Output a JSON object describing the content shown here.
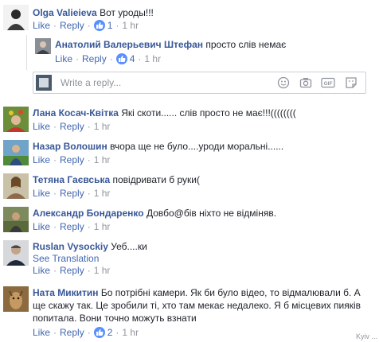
{
  "comments": [
    {
      "author": "Olga Valieieva",
      "text": "Вот уроды!!!",
      "like": "Like",
      "reply": "Reply",
      "reactions": "1",
      "time": "1 hr"
    },
    {
      "author": "Анатолий Валерьевич Штефан",
      "text": "просто слів немає",
      "like": "Like",
      "reply": "Reply",
      "reactions": "4",
      "time": "1 hr"
    },
    {
      "author": "Лана Косач-Квітка",
      "text": "Які скоти...... слів просто не має!!!((((((((",
      "like": "Like",
      "reply": "Reply",
      "time": "1 hr"
    },
    {
      "author": "Назар Волошин",
      "text": "вчора ще не було....уроди моральні......",
      "like": "Like",
      "reply": "Reply",
      "time": "1 hr"
    },
    {
      "author": "Тетяна Гаєвська",
      "text": "повідривати б руки(",
      "like": "Like",
      "reply": "Reply",
      "time": "1 hr"
    },
    {
      "author": "Александр Бондаренко",
      "text": "Довбо@бів ніхто не відміняв.",
      "like": "Like",
      "reply": "Reply",
      "time": "1 hr"
    },
    {
      "author": "Ruslan Vysockiy",
      "text": "Уеб....ки",
      "see_translation": "See Translation",
      "like": "Like",
      "reply": "Reply",
      "time": "1 hr"
    },
    {
      "author": "Ната Микитин",
      "text": "Бо потрібні камери. Як би було відео, то відмалювали б. А ще скажу так. Це зробили ті, хто там мекає недалеко. Я б місцевих пияків попитала. Вони точно можуть взнати",
      "like": "Like",
      "reply": "Reply",
      "reactions": "2",
      "time": "1 hr"
    }
  ],
  "reply_box": {
    "placeholder": "Write a reply..."
  },
  "bottom_text": "Kyiv ...",
  "colors": {
    "link": "#4267b2",
    "author": "#385898",
    "meta": "#90949c",
    "like_badge": "#5890ff"
  }
}
